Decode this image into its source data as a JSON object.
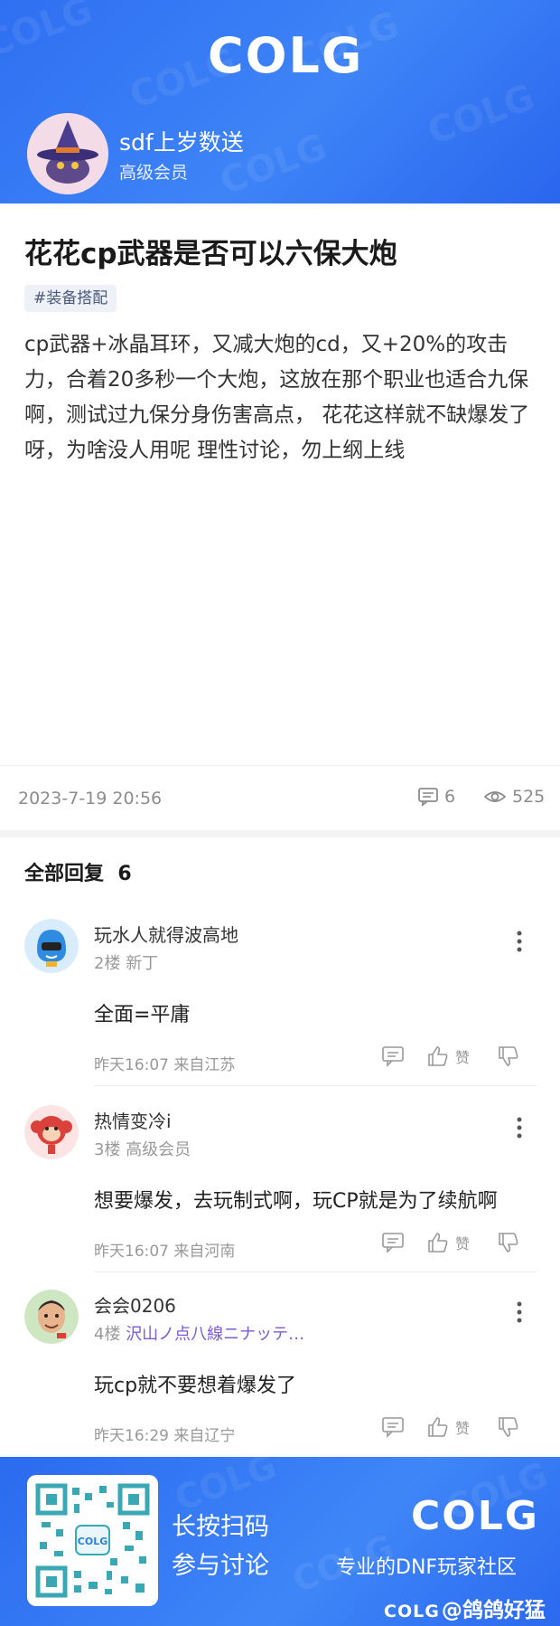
{
  "header": {
    "logo": "COLG",
    "author_name": "sdf上岁数送",
    "author_level": "高级会员"
  },
  "post": {
    "title": "花花cp武器是否可以六保大炮",
    "tag": "#装备搭配",
    "body": "cp武器+冰晶耳环，又减大炮的cd，又+20%的攻击力，合着20多秒一个大炮，这放在那个职业也适合九保啊，测试过九保分身伤害高点， 花花这样就不缺爆发了呀，为啥没人用呢  理性讨论，勿上纲上线",
    "time": "2023-7-19 20:56",
    "comment_count": "6",
    "view_count": "525"
  },
  "replies": {
    "title": "全部回复",
    "count": "6"
  },
  "comments": [
    {
      "name": "玩水人就得波高地",
      "floor": "2楼",
      "level": "新丁",
      "badge": "",
      "text": "全面=平庸",
      "footer": "昨天16:07 来自江苏",
      "like_label": "赞"
    },
    {
      "name": "热情变冷i",
      "floor": "3楼",
      "level": "高级会员",
      "badge": "",
      "text": "想要爆发，去玩制式啊，玩CP就是为了续航啊",
      "footer": "昨天16:07 来自河南",
      "like_label": "赞"
    },
    {
      "name": "会会0206",
      "floor": "4楼",
      "level": "",
      "badge": "沢山ノ点八線ニナッテ…",
      "text": "玩cp就不要想着爆发了",
      "footer": "昨天16:29 来自辽宁",
      "like_label": "赞"
    }
  ],
  "footer": {
    "scan_line1": "长按扫码",
    "scan_line2": "参与讨论",
    "logo": "COLG",
    "slogan": "专业的DNF玩家社区",
    "watermark_logo": "COLG",
    "watermark_text": "@鸽鸽好猛"
  },
  "colors": {
    "brand_blue": "#3a7cf6",
    "badge_purple": "#7b5bd6"
  },
  "icons": [
    "comment-icon",
    "eye-icon",
    "more-icon",
    "reply-icon",
    "thumbs-up-icon",
    "thumbs-down-icon",
    "qr-code"
  ]
}
